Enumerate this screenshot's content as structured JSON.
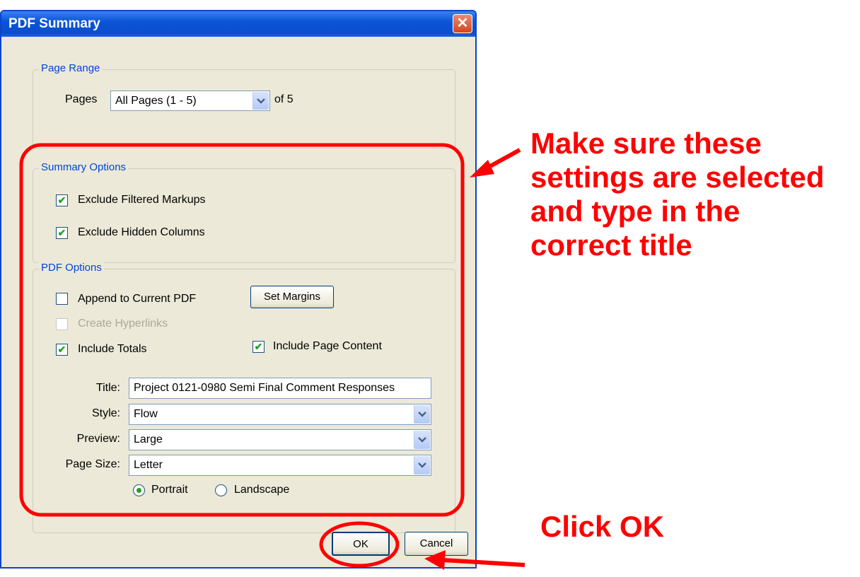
{
  "window": {
    "title": "PDF Summary"
  },
  "page_range": {
    "legend": "Page Range",
    "pages_label": "Pages",
    "pages_value": "All Pages (1 - 5)",
    "of_text": "of 5"
  },
  "summary_options": {
    "legend": "Summary Options",
    "exclude_filtered": {
      "label": "Exclude Filtered Markups",
      "checked": true
    },
    "exclude_hidden": {
      "label": "Exclude Hidden Columns",
      "checked": true
    }
  },
  "pdf_options": {
    "legend": "PDF Options",
    "append": {
      "label": "Append to Current PDF",
      "checked": false
    },
    "hyperlinks": {
      "label": "Create Hyperlinks",
      "checked": false,
      "disabled": true
    },
    "totals": {
      "label": "Include Totals",
      "checked": true
    },
    "page_content": {
      "label": "Include Page Content",
      "checked": true
    },
    "set_margins_label": "Set Margins",
    "title_label": "Title:",
    "title_value": "Project 0121-0980 Semi Final Comment Responses",
    "style_label": "Style:",
    "style_value": "Flow",
    "preview_label": "Preview:",
    "preview_value": "Large",
    "page_size_label": "Page Size:",
    "page_size_value": "Letter",
    "portrait_label": "Portrait",
    "landscape_label": "Landscape",
    "orientation_selected": "Portrait"
  },
  "buttons": {
    "ok": "OK",
    "cancel": "Cancel"
  },
  "annotations": {
    "settings_note": [
      "Make sure these",
      "settings are selected",
      "and type in the",
      "correct title"
    ],
    "click_ok": "Click OK",
    "color": "#ff0000"
  },
  "colors": {
    "titlebar": "#0b54d8",
    "dialog_bg": "#ece9d8",
    "legend_text": "#0046d5",
    "check_mark": "#21a121"
  }
}
